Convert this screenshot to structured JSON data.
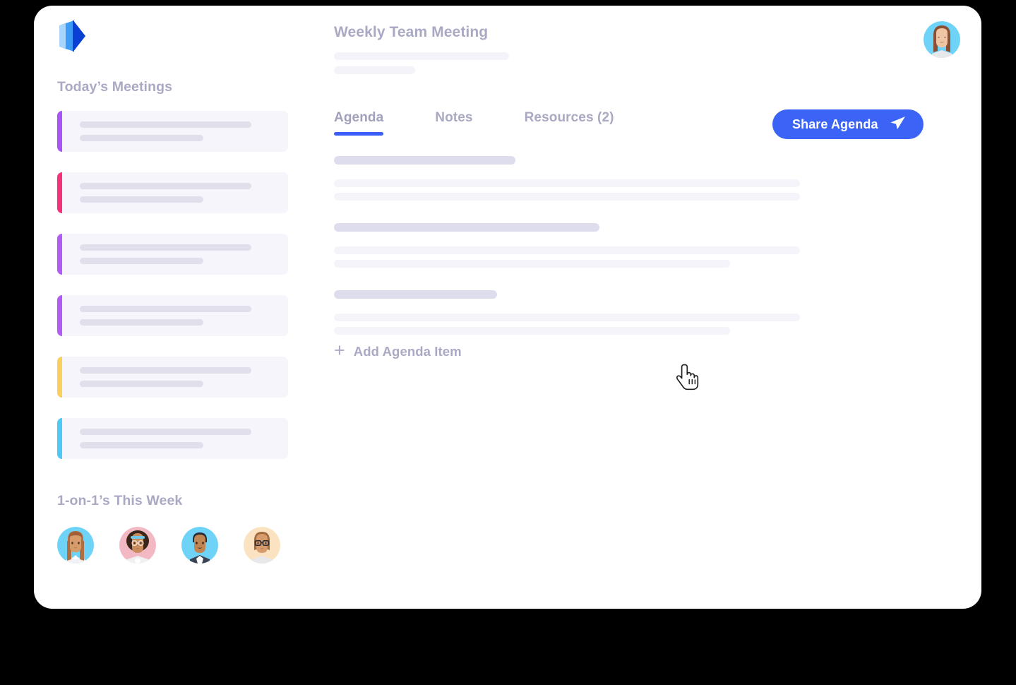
{
  "app": {
    "logo_icon": "layered-blue-chevron-logo"
  },
  "sidebar": {
    "todays_meetings_heading": "Today’s Meetings",
    "one_on_one_heading": "1-on-1’s This Week",
    "meetings": [
      {
        "accent": "#a855f7",
        "name": "meeting-card-1"
      },
      {
        "accent": "#f6317c",
        "name": "meeting-card-2"
      },
      {
        "accent": "#b05cf5",
        "name": "meeting-card-3"
      },
      {
        "accent": "#b05cf5",
        "name": "meeting-card-4"
      },
      {
        "accent": "#fbcf5c",
        "name": "meeting-card-5"
      },
      {
        "accent": "#4ec8f5",
        "name": "meeting-card-6"
      }
    ],
    "avatars": [
      {
        "name": "avatar-person-1",
        "bg": "#6fd3f7",
        "hair": "#b06f43",
        "skin": "#d89b6c",
        "shirt": "#f0f0f2"
      },
      {
        "name": "avatar-person-2",
        "bg": "#f2b9c4",
        "hair": "#3b2418",
        "skin": "#c98c5e",
        "shirt": "#f0f0f2"
      },
      {
        "name": "avatar-person-3",
        "bg": "#6fd3f7",
        "hair": "#2b2b33",
        "skin": "#c08552",
        "shirt": "#3c4354"
      },
      {
        "name": "avatar-person-4",
        "bg": "#fbe3c2",
        "hair": "#a36b3f",
        "skin": "#d89b6c",
        "shirt": "#e8e8ea"
      }
    ]
  },
  "header": {
    "title": "Weekly Team Meeting",
    "user_avatar": {
      "name": "user-avatar",
      "bg": "#6fd3f7",
      "hair": "#8b4f33",
      "skin": "#f0c5a6",
      "shirt": "#e8e8ea"
    }
  },
  "tabs": [
    {
      "label": "Agenda",
      "active": true
    },
    {
      "label": "Notes",
      "active": false
    },
    {
      "label": "Resources (2)",
      "active": false
    }
  ],
  "toolbar": {
    "share_label": "Share Agenda",
    "share_icon": "send-plane-icon",
    "accent_color": "#3b64f6"
  },
  "agenda": {
    "blocks": [
      {
        "head_width": "39%",
        "body_widths": [
          "100%",
          "100%"
        ]
      },
      {
        "head_width": "57%",
        "body_widths": [
          "100%",
          "85%"
        ]
      },
      {
        "head_width": "35%",
        "body_widths": [
          "100%",
          "85%"
        ]
      }
    ],
    "add_item_plus": "+",
    "add_item_label": "Add Agenda Item"
  },
  "cursor": {
    "icon": "pointing-hand-cursor"
  }
}
